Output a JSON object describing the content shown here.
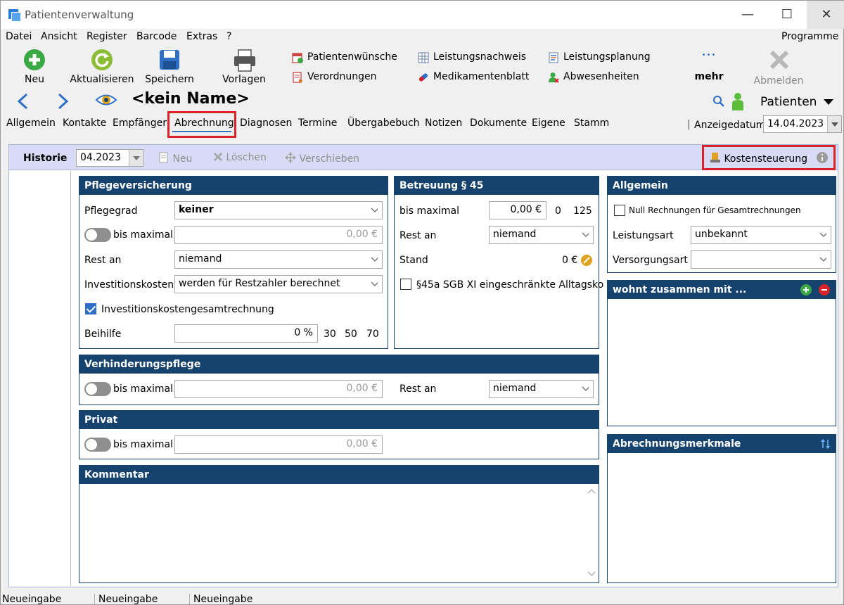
{
  "window": {
    "title": "Patientenverwaltung",
    "minimize": "—",
    "maximize": "☐",
    "close": "✕"
  },
  "menu": [
    "Datei",
    "Ansicht",
    "Register",
    "Barcode",
    "Extras",
    "?"
  ],
  "menu_right": "Programme",
  "toolbar": {
    "neu": "Neu",
    "aktualisieren": "Aktualisieren",
    "speichern": "Speichern",
    "vorlagen": "Vorlagen",
    "patientenwuensche": "Patientenwünsche",
    "verordnungen": "Verordnungen",
    "leistungsnachweis": "Leistungsnachweis",
    "medikamentenblatt": "Medikamentenblatt",
    "leistungsplanung": "Leistungsplanung",
    "abwesenheiten": "Abwesenheiten",
    "mehr_dots": "•••",
    "mehr": "mehr",
    "abmelden": "Abmelden"
  },
  "patient": {
    "name": "<kein Name>",
    "patienten_dropdown": "Patienten"
  },
  "tabs": [
    "Allgemein",
    "Kontakte",
    "Empfänger",
    "Abrechnung",
    "Diagnosen",
    "Termine",
    "Übergabebuch",
    "Notizen",
    "Dokumente",
    "Eigene",
    "Stamm"
  ],
  "active_tab": "Abrechnung",
  "anzeigedatum": {
    "label": "Anzeigedatum",
    "value": "14.04.2023",
    "sep": "|"
  },
  "historie": {
    "label": "Historie",
    "value": "04.2023",
    "neu": "Neu",
    "loeschen": "Löschen",
    "verschieben": "Verschieben",
    "kostensteuerung": "Kostensteuerung"
  },
  "pflegeversicherung": {
    "title": "Pflegeversicherung",
    "pflegegrad_label": "Pflegegrad",
    "pflegegrad_value": "keiner",
    "bis_maximal_label": "bis maximal",
    "bis_maximal_value": "0,00 €",
    "rest_an_label": "Rest an",
    "rest_an_value": "niemand",
    "investitionskosten_label": "Investitionskosten",
    "investitionskosten_value": "werden für Restzahler berechnet",
    "gesamtrechnung_label": "Investitionskostengesamtrechnung",
    "gesamtrechnung_checked": true,
    "beihilfe_label": "Beihilfe",
    "beihilfe_value": "0 %",
    "beihilfe_presets": [
      "30",
      "50",
      "70"
    ]
  },
  "betreuung": {
    "title": "Betreuung § 45",
    "bis_maximal_label": "bis maximal",
    "bis_maximal_value": "0,00 €",
    "presets": [
      "0",
      "125"
    ],
    "rest_an_label": "Rest an",
    "rest_an_value": "niemand",
    "stand_label": "Stand",
    "stand_value": "0 €",
    "paragraph_label": "§45a SGB XI eingeschränkte Alltagsko",
    "paragraph_checked": false
  },
  "verhinderungspflege": {
    "title": "Verhinderungspflege",
    "bis_maximal_label": "bis maximal",
    "bis_maximal_value": "0,00 €",
    "rest_an_label": "Rest an",
    "rest_an_value": "niemand"
  },
  "privat": {
    "title": "Privat",
    "bis_maximal_label": "bis maximal",
    "bis_maximal_value": "0,00 €"
  },
  "kommentar": {
    "title": "Kommentar"
  },
  "allgemein": {
    "title": "Allgemein",
    "null_rechnungen_label": "Null Rechnungen für Gesamtrechnungen",
    "null_rechnungen_checked": false,
    "leistungsart_label": "Leistungsart",
    "leistungsart_value": "unbekannt",
    "versorgungsart_label": "Versorgungsart",
    "versorgungsart_value": ""
  },
  "wohnt_zusammen": {
    "title": "wohnt zusammen mit ..."
  },
  "abrechnungsmerkmale": {
    "title": "Abrechnungsmerkmale"
  },
  "status": [
    "Neueingabe",
    "Neueingabe",
    "Neueingabe"
  ],
  "colors": {
    "panel_header": "#16426e",
    "highlight": "#d8232a",
    "accent": "#2f6fc6",
    "hist_bar": "#d9dbf6"
  }
}
